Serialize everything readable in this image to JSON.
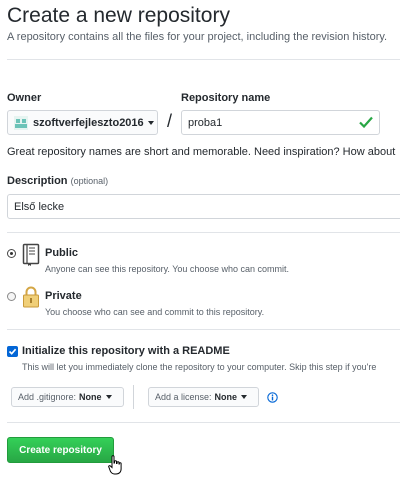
{
  "page": {
    "title": "Create a new repository",
    "subtitle": "A repository contains all the files for your project, including the revision history."
  },
  "owner": {
    "label": "Owner",
    "value": "szoftverfejleszto2016"
  },
  "repository": {
    "label": "Repository name",
    "value": "proba1",
    "separator": "/"
  },
  "name_hint": "Great repository names are short and memorable. Need inspiration? How about",
  "description": {
    "label": "Description",
    "optional": "(optional)",
    "value": "Első lecke"
  },
  "visibility": {
    "public": {
      "title": "Public",
      "description": "Anyone can see this repository. You choose who can commit.",
      "selected": true
    },
    "private": {
      "title": "Private",
      "description": "You choose who can see and commit to this repository.",
      "selected": false
    }
  },
  "readme": {
    "label": "Initialize this repository with a README",
    "hint": "This will let you immediately clone the repository to your computer. Skip this step if you're",
    "checked": true
  },
  "gitignore": {
    "label": "Add .gitignore:",
    "value": "None"
  },
  "license": {
    "label": "Add a license:",
    "value": "None"
  },
  "create_button": "Create repository",
  "colors": {
    "accent_green": "#28a745",
    "checkbox_blue": "#0366d6",
    "info_blue": "#0366d6"
  }
}
